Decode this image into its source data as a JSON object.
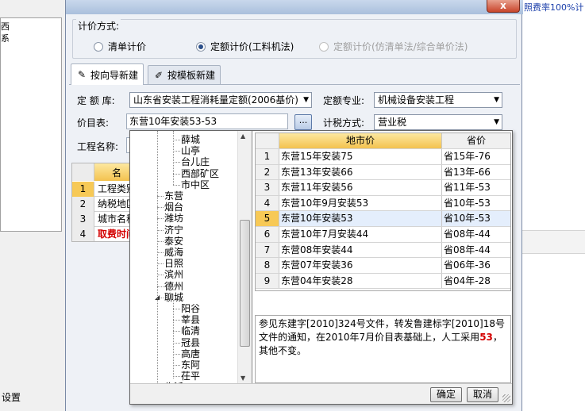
{
  "background": {
    "tree_items": [
      "西",
      "系"
    ],
    "bottom_text": "设置",
    "right_top_text": "照费率100%计日"
  },
  "dialog": {
    "close_glyph": "x",
    "pricing": {
      "title": "计价方式:",
      "options": [
        {
          "label": "清单计价",
          "checked": false,
          "disabled": false
        },
        {
          "label": "定额计价(工料机法)",
          "checked": true,
          "disabled": false
        },
        {
          "label": "定额计价(仿清单法/综合单价法)",
          "checked": false,
          "disabled": true
        }
      ]
    },
    "tabs": [
      {
        "label": "按向导新建",
        "icon": "wizard-icon",
        "active": true
      },
      {
        "label": "按模板新建",
        "icon": "template-icon",
        "active": false
      }
    ],
    "form": {
      "quota_lib_label": "定 额 库:",
      "quota_lib_value": "山东省安装工程消耗量定额(2006基价)",
      "quota_major_label": "定额专业:",
      "quota_major_value": "机械设备安装工程",
      "price_list_label": "价目表:",
      "price_list_value": "东营10年安装53-53",
      "browse_label": "...",
      "tax_label": "计税方式:",
      "tax_value": "营业税",
      "project_name_label": "工程名称:"
    },
    "bg_grid": {
      "header": "名",
      "rows": [
        {
          "num": "1",
          "text": "工程类别",
          "selected": true,
          "red": false
        },
        {
          "num": "2",
          "text": "纳税地区",
          "selected": false,
          "red": false
        },
        {
          "num": "3",
          "text": "城市名称",
          "selected": false,
          "red": false
        },
        {
          "num": "4",
          "text": "取费时间",
          "selected": false,
          "red": true
        }
      ]
    }
  },
  "popup": {
    "tree": [
      {
        "label": "薛城",
        "level": 2
      },
      {
        "label": "山亭",
        "level": 2
      },
      {
        "label": "台儿庄",
        "level": 2
      },
      {
        "label": "西部矿区",
        "level": 2
      },
      {
        "label": "市中区",
        "level": 2
      },
      {
        "label": "东营",
        "level": 1
      },
      {
        "label": "烟台",
        "level": 1
      },
      {
        "label": "潍坊",
        "level": 1
      },
      {
        "label": "济宁",
        "level": 1
      },
      {
        "label": "泰安",
        "level": 1
      },
      {
        "label": "威海",
        "level": 1
      },
      {
        "label": "日照",
        "level": 1
      },
      {
        "label": "滨州",
        "level": 1
      },
      {
        "label": "德州",
        "level": 1
      },
      {
        "label": "聊城",
        "level": 1,
        "expanded": true
      },
      {
        "label": "阳谷",
        "level": 2
      },
      {
        "label": "莘县",
        "level": 2
      },
      {
        "label": "临清",
        "level": 2
      },
      {
        "label": "冠县",
        "level": 2
      },
      {
        "label": "高唐",
        "level": 2
      },
      {
        "label": "东阿",
        "level": 2
      },
      {
        "label": "茌平",
        "level": 2
      },
      {
        "label": "临沂",
        "level": 1
      }
    ],
    "grid": {
      "col1": "地市价",
      "col2": "省价",
      "rows": [
        {
          "num": "1",
          "city": "东营15年安装75",
          "prov": "省15年-76"
        },
        {
          "num": "2",
          "city": "东营13年安装66",
          "prov": "省13年-66"
        },
        {
          "num": "3",
          "city": "东营11年安装56",
          "prov": "省11年-53"
        },
        {
          "num": "4",
          "city": "东营10年9月安装53",
          "prov": "省10年-53"
        },
        {
          "num": "5",
          "city": "东营10年安装53",
          "prov": "省10年-53",
          "selected": true
        },
        {
          "num": "6",
          "city": "东营10年7月安装44",
          "prov": "省08年-44"
        },
        {
          "num": "7",
          "city": "东营08年安装44",
          "prov": "省08年-44"
        },
        {
          "num": "8",
          "city": "东营07年安装36",
          "prov": "省06年-36"
        },
        {
          "num": "9",
          "city": "东营04年安装28",
          "prov": "省04年-28"
        }
      ]
    },
    "description": {
      "before": "参见东建字[2010]324号文件，转发鲁建标字[2010]18号文件的通知，在2010年7月价目表基础上，人工采用",
      "highlight": "53",
      "after": "，其他不变。"
    },
    "ok_label": "确定",
    "cancel_label": "取消"
  },
  "colors": {
    "grid_header": "#f3c24f",
    "selected_row_number": "#f7c956",
    "highlight_text": "#d40000",
    "link_text": "#1a3eaa"
  }
}
